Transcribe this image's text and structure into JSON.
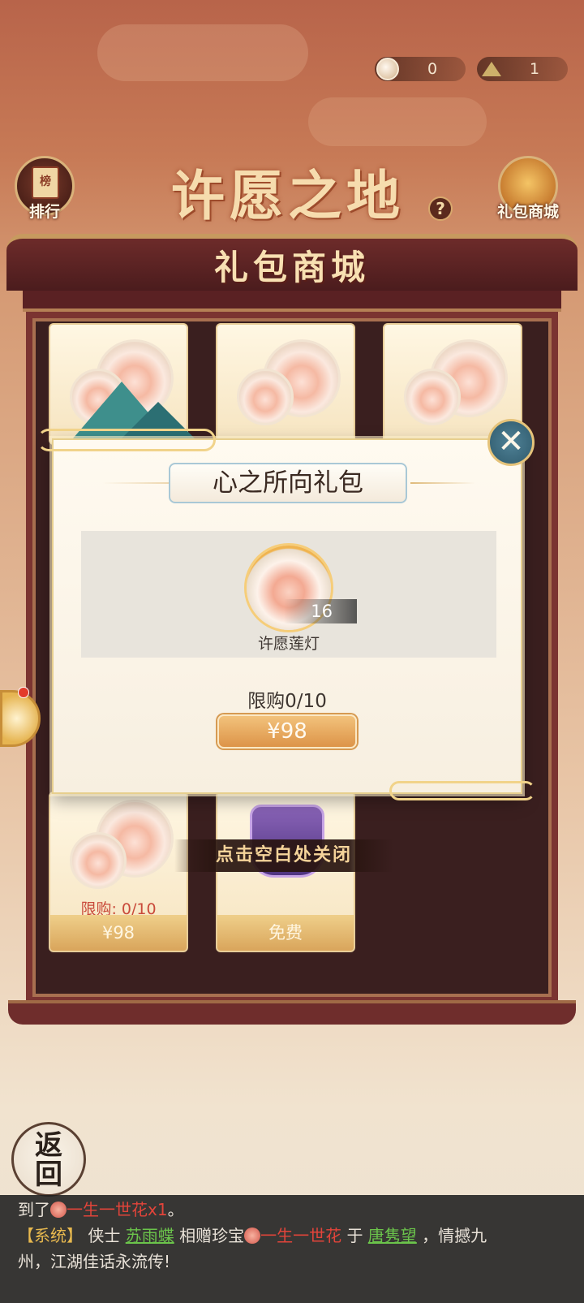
{
  "currency": [
    {
      "icon": "lotus-coin-icon",
      "value": "0"
    },
    {
      "icon": "ginkgo-leaf-icon",
      "value": "1"
    }
  ],
  "header": {
    "main_title": "许愿之地",
    "help_label": "?",
    "left_button": "排行",
    "left_button_badge": "榜",
    "right_button": "礼包商城"
  },
  "shop": {
    "title": "礼包商城",
    "cards_bottom": [
      {
        "limit": "限购: 0/10",
        "price": "¥98"
      },
      {
        "price": "免费"
      }
    ],
    "close_hint": "点击空白处关闭"
  },
  "popup": {
    "title": "心之所向礼包",
    "item": {
      "name": "许愿莲灯",
      "count": "16"
    },
    "limit": "限购0/10",
    "price": "¥98",
    "close_label": "✕"
  },
  "chat": {
    "line1_prefix": "到了",
    "line1_item": "一生一世花x1",
    "line1_end": "。",
    "line2_tag": "【系统】",
    "line2_a": "侠士",
    "line2_user1": "苏雨蝶",
    "line2_b": "相赠珍宝",
    "line2_item": "一生一世花",
    "line2_c": "于",
    "line2_user2": "唐隽望",
    "line2_d": "，情撼九",
    "line3": "州，江湖佳话永流传!"
  },
  "back_button": {
    "line1": "返",
    "line2": "回"
  },
  "colors": {
    "accent_gold": "#dd9448",
    "popup_bg": "#fffaf0",
    "cabinet": "#3a1f1f"
  }
}
